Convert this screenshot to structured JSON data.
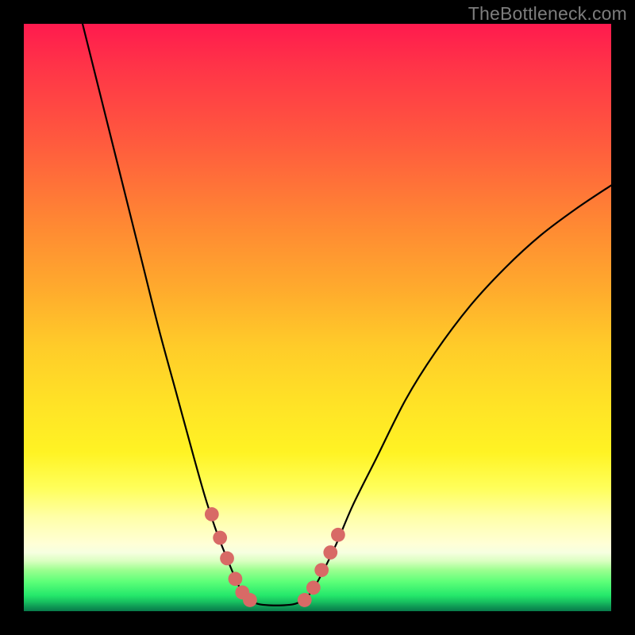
{
  "watermark": "TheBottleneck.com",
  "colors": {
    "frame": "#000000",
    "curve": "#000000",
    "marker": "#d86a66",
    "gradient_top": "#ff1a4e",
    "gradient_mid": "#ffe326",
    "gradient_bottom": "#087a4a"
  },
  "chart_data": {
    "type": "line",
    "title": "",
    "xlabel": "",
    "ylabel": "",
    "xlim": [
      0,
      100
    ],
    "ylim": [
      0,
      100
    ],
    "grid": false,
    "legend": false,
    "notes": "No numeric axis labels are shown; the chart is a bottleneck curve plotted over a vertical red→green gradient. X and Y values are expressed as percent of plot width/height (0,0 at bottom-left). Two branches descend from the top edges into a flat trough near the bottom, then the right branch rises again.",
    "series": [
      {
        "name": "left-branch",
        "x": [
          10.0,
          12.0,
          14.5,
          17.0,
          20.0,
          23.0,
          26.0,
          29.0,
          31.0,
          33.0,
          35.0,
          36.5,
          38.0
        ],
        "y": [
          100.0,
          92.0,
          82.0,
          72.0,
          60.0,
          48.0,
          37.0,
          26.0,
          19.0,
          13.0,
          8.0,
          4.5,
          2.0
        ]
      },
      {
        "name": "trough",
        "x": [
          38.0,
          40.0,
          42.0,
          44.0,
          46.0,
          48.0
        ],
        "y": [
          2.0,
          1.2,
          1.0,
          1.0,
          1.2,
          2.0
        ]
      },
      {
        "name": "right-branch",
        "x": [
          48.0,
          50.0,
          53.0,
          56.0,
          60.0,
          65.0,
          70.0,
          76.0,
          82.0,
          88.0,
          94.0,
          100.0
        ],
        "y": [
          2.0,
          5.0,
          11.0,
          18.0,
          26.0,
          36.0,
          44.0,
          52.0,
          58.5,
          64.0,
          68.5,
          72.5
        ]
      }
    ],
    "markers": {
      "name": "highlight-dots",
      "color": "#d86a66",
      "radius_pct": 1.2,
      "points_xy": [
        [
          32.0,
          16.5
        ],
        [
          33.4,
          12.5
        ],
        [
          34.6,
          9.0
        ],
        [
          36.0,
          5.5
        ],
        [
          37.2,
          3.2
        ],
        [
          38.5,
          1.9
        ],
        [
          47.8,
          1.9
        ],
        [
          49.3,
          4.0
        ],
        [
          50.7,
          7.0
        ],
        [
          52.2,
          10.0
        ],
        [
          53.5,
          13.0
        ]
      ]
    }
  }
}
